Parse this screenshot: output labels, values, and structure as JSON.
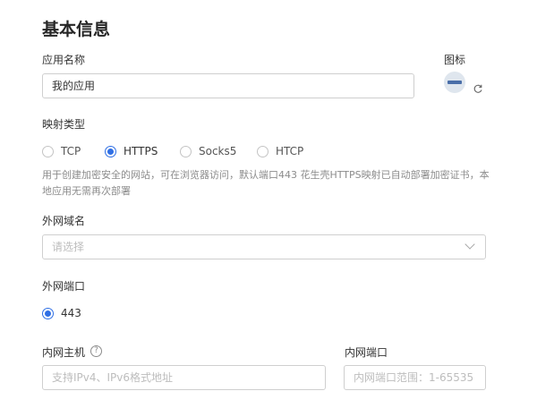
{
  "section_title": "基本信息",
  "app_name": {
    "label": "应用名称",
    "value": "我的应用"
  },
  "icon": {
    "label": "图标",
    "refresh_icon": "refresh-icon",
    "avatar_icon": "app-avatar-icon"
  },
  "mapping_type": {
    "label": "映射类型",
    "options": [
      {
        "label": "TCP",
        "selected": false
      },
      {
        "label": "HTTPS",
        "selected": true
      },
      {
        "label": "Socks5",
        "selected": false
      },
      {
        "label": "HTCP",
        "selected": false
      }
    ],
    "hint": "用于创建加密安全的网站，可在浏览器访问，默认端口443 花生壳HTTPS映射已自动部署加密证书，本地应用无需再次部署"
  },
  "domain": {
    "label": "外网域名",
    "placeholder": "请选择"
  },
  "external_port": {
    "label": "外网端口",
    "options": [
      {
        "label": "443",
        "selected": true
      }
    ]
  },
  "internal_host": {
    "label": "内网主机",
    "help_icon": "?",
    "placeholder": "支持IPv4、IPv6格式地址"
  },
  "internal_port": {
    "label": "内网端口",
    "placeholder": "内网端口范围：1-65535"
  },
  "colors": {
    "accent": "#2f6fe4",
    "border": "#cfcfcf",
    "hint": "#8c8c8c"
  }
}
